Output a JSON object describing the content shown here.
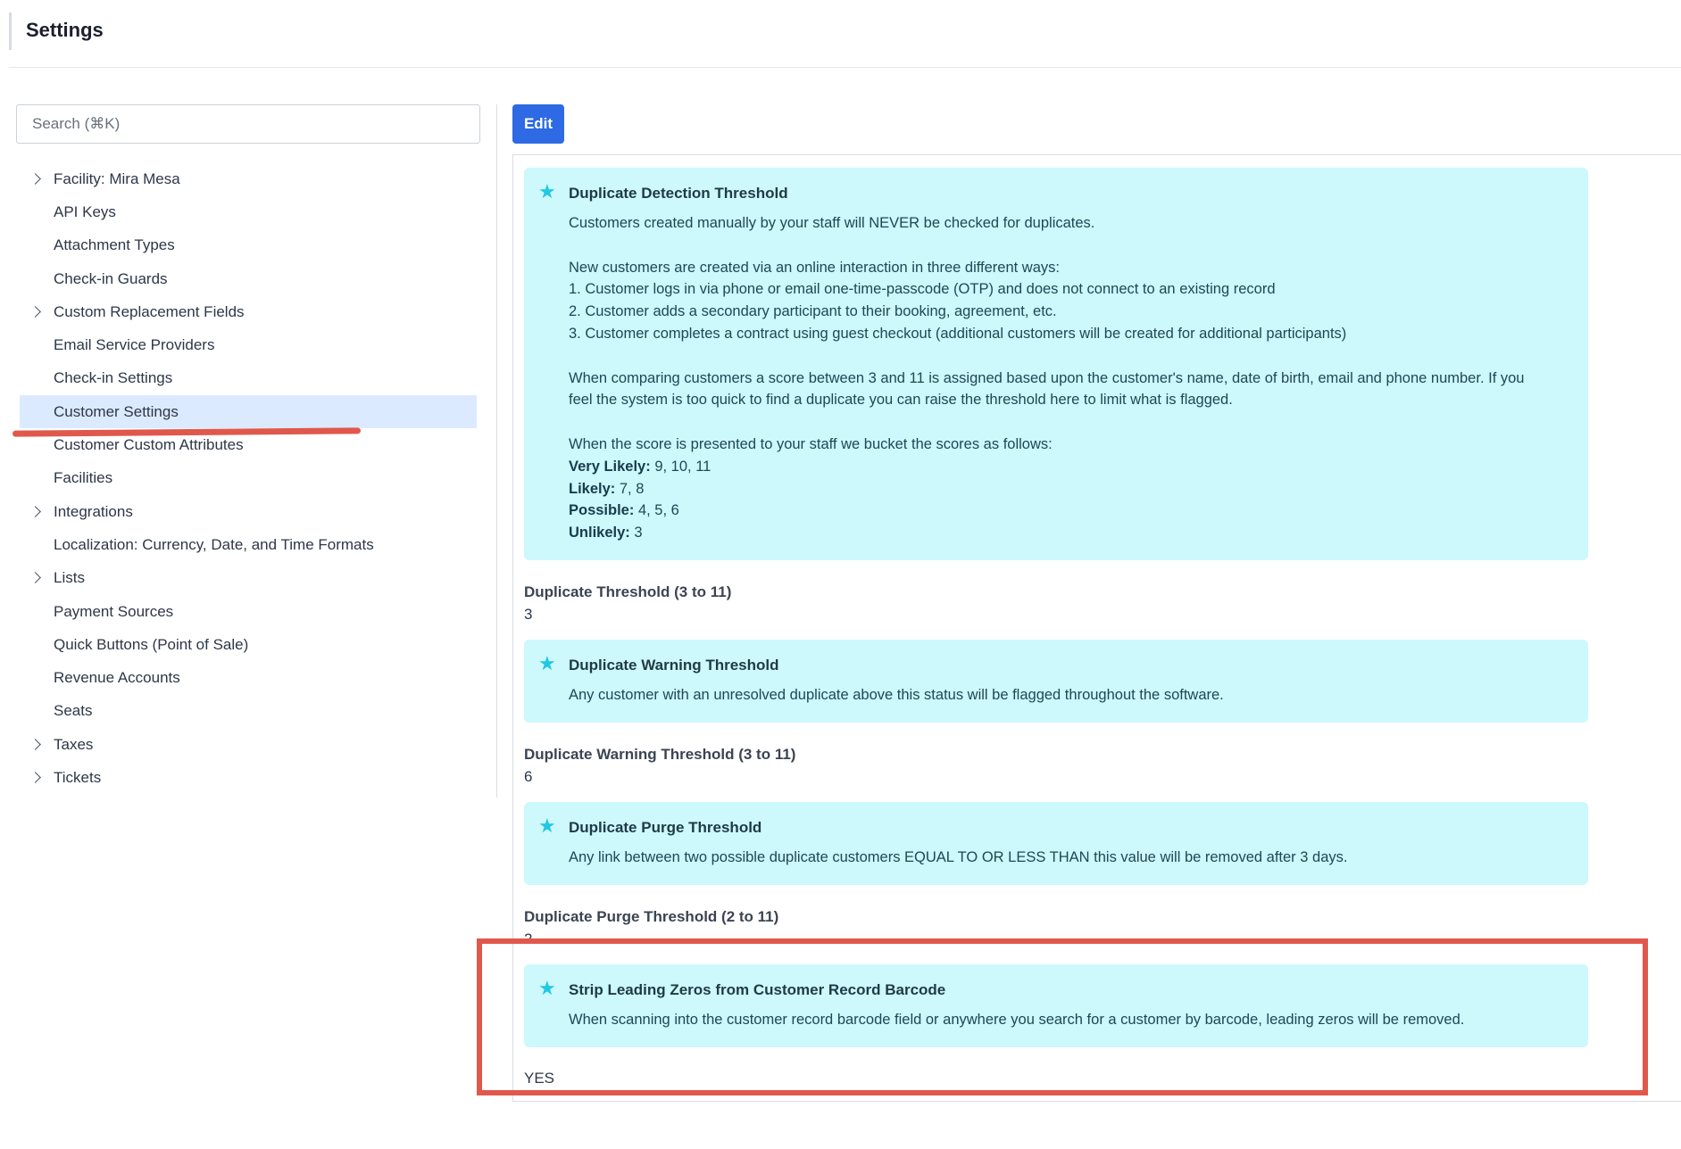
{
  "header": {
    "title": "Settings"
  },
  "sidebar": {
    "search_placeholder": "Search (⌘K)",
    "items": [
      {
        "label": "Facility: Mira Mesa",
        "expandable": true
      },
      {
        "label": "API Keys"
      },
      {
        "label": "Attachment Types"
      },
      {
        "label": "Check-in Guards"
      },
      {
        "label": "Custom Replacement Fields",
        "expandable": true
      },
      {
        "label": "Email Service Providers"
      },
      {
        "label": "Check-in Settings"
      },
      {
        "label": "Customer Settings",
        "selected": true
      },
      {
        "label": "Customer Custom Attributes"
      },
      {
        "label": "Facilities"
      },
      {
        "label": "Integrations",
        "expandable": true
      },
      {
        "label": "Localization: Currency, Date, and Time Formats"
      },
      {
        "label": "Lists",
        "expandable": true
      },
      {
        "label": "Payment Sources"
      },
      {
        "label": "Quick Buttons (Point of Sale)"
      },
      {
        "label": "Revenue Accounts"
      },
      {
        "label": "Seats"
      },
      {
        "label": "Taxes",
        "expandable": true
      },
      {
        "label": "Tickets",
        "expandable": true
      }
    ]
  },
  "toolbar": {
    "edit_label": "Edit"
  },
  "sections": {
    "detection": {
      "title": "Duplicate Detection Threshold",
      "line1": "Customers created manually by your staff will NEVER be checked for duplicates.",
      "line2": "New customers are created via an online interaction in three different ways:",
      "line3": "1. Customer logs in via phone or email one-time-passcode (OTP) and does not connect to an existing record",
      "line4": "2. Customer adds a secondary participant to their booking, agreement, etc.",
      "line5": "3. Customer completes a contract using guest checkout (additional customers will be created for additional participants)",
      "line6": "When comparing customers a score between 3 and 11 is assigned based upon the customer's name, date of birth, email and phone number. If you",
      "line7": "feel the system is too quick to find a duplicate you can raise the threshold here to limit what is flagged.",
      "line8": "When the score is presented to your staff we bucket the scores as follows:",
      "buckets": [
        {
          "label": "Very Likely:",
          "values": "9, 10, 11"
        },
        {
          "label": "Likely:",
          "values": "7, 8"
        },
        {
          "label": "Possible:",
          "values": "4, 5, 6"
        },
        {
          "label": "Unlikely:",
          "values": "3"
        }
      ],
      "field_label": "Duplicate Threshold (3 to 11)",
      "field_value": "3"
    },
    "warning": {
      "title": "Duplicate Warning Threshold",
      "description": "Any customer with an unresolved duplicate above this status will be flagged throughout the software.",
      "field_label": "Duplicate Warning Threshold (3 to 11)",
      "field_value": "6"
    },
    "purge": {
      "title": "Duplicate Purge Threshold",
      "description": "Any link between two possible duplicate customers EQUAL TO OR LESS THAN this value will be removed after 3 days.",
      "field_label": "Duplicate Purge Threshold (2 to 11)",
      "field_value": "2"
    },
    "strip": {
      "title": "Strip Leading Zeros from Customer Record Barcode",
      "description": "When scanning into the customer record barcode field or anywhere you search for a customer by barcode, leading zeros will be removed.",
      "field_value": "YES"
    }
  },
  "icons": {
    "section_icon": "star-icon",
    "expand_icon": "chevron-right-icon"
  },
  "colors": {
    "accent": "#2d6ae3",
    "info_bg": "#cdf8fc",
    "star": "#22c7e3",
    "selected_bg": "#dceaff",
    "annotation": "#e0584c"
  }
}
